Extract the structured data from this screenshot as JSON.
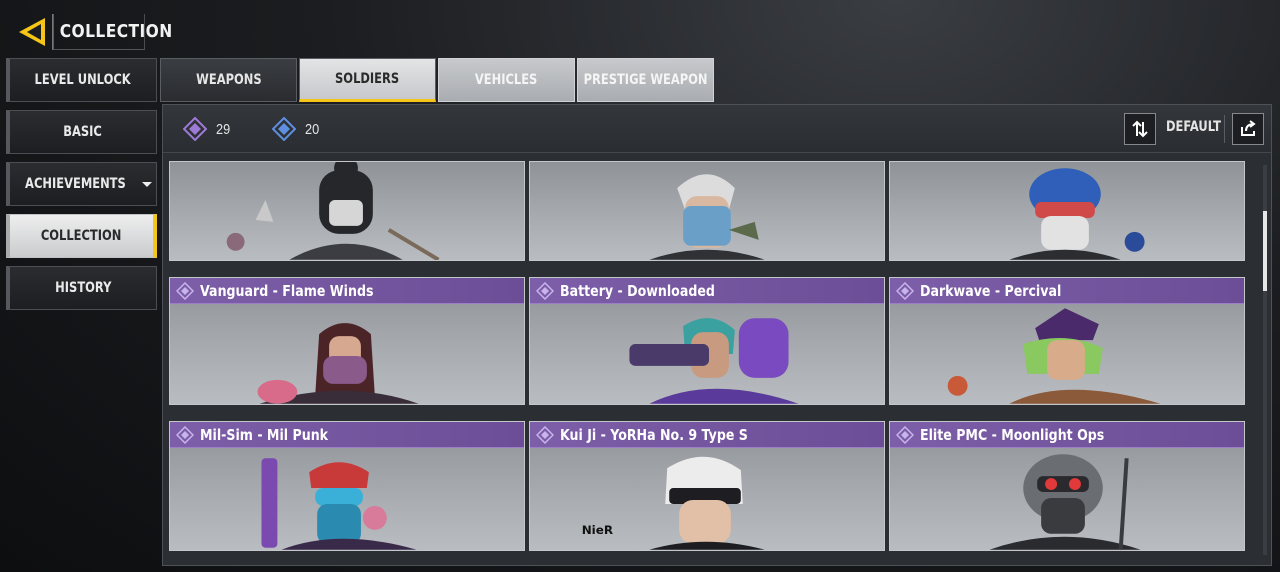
{
  "header": {
    "title": "COLLECTION",
    "back_icon": "back-chevron-icon",
    "accent": "#f5c518"
  },
  "sidebar": {
    "items": [
      {
        "label": "LEVEL UNLOCK",
        "active": false
      },
      {
        "label": "BASIC",
        "active": false
      },
      {
        "label": "ACHIEVEMENTS",
        "active": false,
        "has_dropdown": true
      },
      {
        "label": "COLLECTION",
        "active": true
      },
      {
        "label": "HISTORY",
        "active": false
      }
    ]
  },
  "tabs": [
    {
      "label": "WEAPONS",
      "state": "normal"
    },
    {
      "label": "SOLDIERS",
      "state": "active"
    },
    {
      "label": "VEHICLES",
      "state": "light"
    },
    {
      "label": "PRESTIGE WEAPON",
      "state": "light"
    }
  ],
  "filters": {
    "counts": [
      {
        "icon": "purple-diamond-icon",
        "value": "29",
        "color": "#9c7ad6"
      },
      {
        "icon": "blue-diamond-icon",
        "value": "20",
        "color": "#5e8fe0"
      }
    ],
    "sort_label": "DEFAULT",
    "sort_icon": "sort-arrows-icon",
    "share_icon": "share-icon"
  },
  "cards": [
    {
      "name": "",
      "rarity": "none"
    },
    {
      "name": "",
      "rarity": "none"
    },
    {
      "name": "",
      "rarity": "none"
    },
    {
      "name": "Vanguard - Flame Winds",
      "rarity": "epic"
    },
    {
      "name": "Battery - Downloaded",
      "rarity": "epic"
    },
    {
      "name": "Darkwave - Percival",
      "rarity": "epic"
    },
    {
      "name": "Mil-Sim - Mil Punk",
      "rarity": "epic"
    },
    {
      "name": "Kui Ji - YoRHa No. 9 Type S",
      "rarity": "epic"
    },
    {
      "name": "Elite PMC - Moonlight Ops",
      "rarity": "epic"
    }
  ],
  "logo_texts": {
    "nier": "NieR"
  }
}
